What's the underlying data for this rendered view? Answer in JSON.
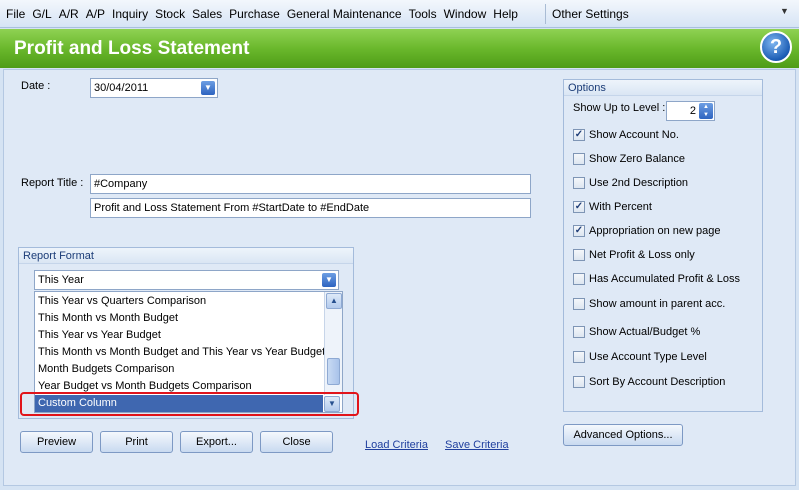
{
  "menu": {
    "items": [
      "File",
      "G/L",
      "A/R",
      "A/P",
      "Inquiry",
      "Stock",
      "Sales",
      "Purchase",
      "General Maintenance",
      "Tools",
      "Window",
      "Help"
    ],
    "other": "Other Settings"
  },
  "header": {
    "title": "Profit and Loss Statement",
    "help_icon": "?"
  },
  "date": {
    "label": "Date :",
    "value": "30/04/2011"
  },
  "report_title": {
    "label": "Report Title :",
    "line1": "#Company",
    "line2": "Profit and Loss Statement From #StartDate to #EndDate"
  },
  "report_format": {
    "group_title": "Report Format",
    "selected": "This Year",
    "options": [
      "This Year vs Quarters Comparison",
      "This Month vs Month Budget",
      "This Year vs Year Budget",
      "This Month vs Month Budget and This Year vs Year Budget",
      "Month Budgets Comparison",
      "Year Budget vs Month Budgets Comparison"
    ],
    "highlighted": "Custom Column"
  },
  "buttons": {
    "preview": "Preview",
    "print": "Print",
    "export": "Export...",
    "close": "Close",
    "load_criteria": "Load Criteria",
    "save_criteria": "Save Criteria",
    "advanced": "Advanced Options..."
  },
  "options": {
    "title": "Options",
    "level_label": "Show Up to Level :",
    "level_value": "2",
    "checks": [
      {
        "label": "Show Account No.",
        "checked": true
      },
      {
        "label": "Show Zero Balance",
        "checked": false
      },
      {
        "label": "Use 2nd Description",
        "checked": false
      },
      {
        "label": "With Percent",
        "checked": true
      },
      {
        "label": "Appropriation on new page",
        "checked": true
      },
      {
        "label": "Net Profit & Loss only",
        "checked": false
      },
      {
        "label": "Has Accumulated Profit & Loss",
        "checked": false
      },
      {
        "label": "Show amount in parent acc.",
        "checked": false
      },
      {
        "label": "Show Actual/Budget %",
        "checked": false
      },
      {
        "label": "Use Account Type Level",
        "checked": false
      },
      {
        "label": "Sort By Account Description",
        "checked": false
      }
    ]
  },
  "colors": {
    "header_green": "#6ab82c",
    "selection_blue": "#3f67b0",
    "highlight_red": "#e1141b"
  }
}
